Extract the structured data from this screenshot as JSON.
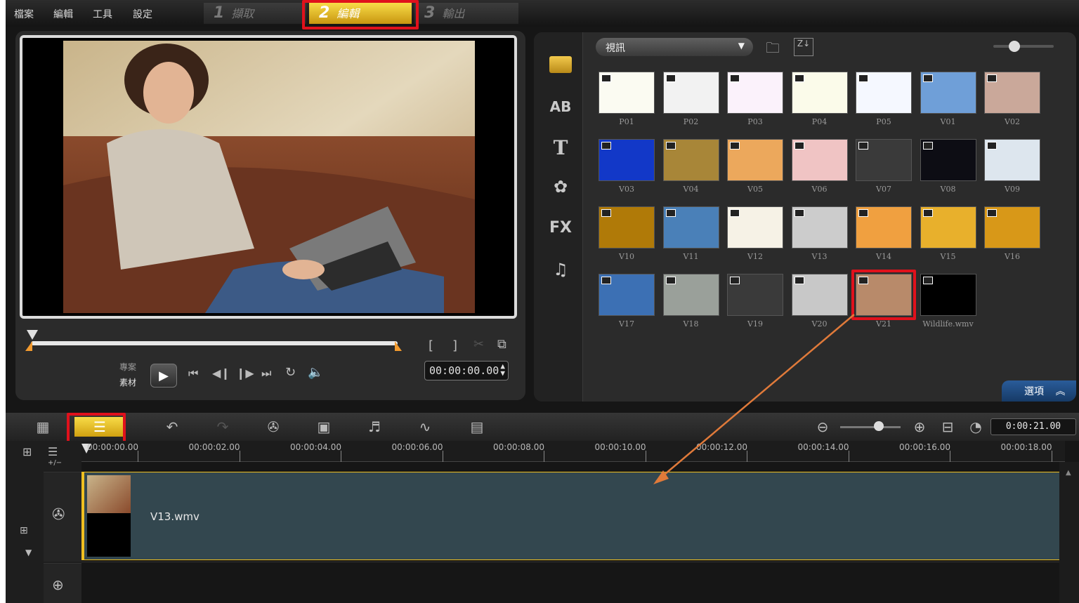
{
  "menu": {
    "file": "檔案",
    "edit": "編輯",
    "tools": "工具",
    "settings": "設定"
  },
  "steps": [
    {
      "num": "1",
      "label": "擷取"
    },
    {
      "num": "2",
      "label": "編輯"
    },
    {
      "num": "3",
      "label": "輸出"
    }
  ],
  "preview": {
    "mark_in": "[",
    "mark_out": "]",
    "mode_project": "專案",
    "mode_clip": "素材",
    "timecode": "00:00:00.00"
  },
  "library": {
    "category": "視訊",
    "options_label": "選項",
    "tab_icons": [
      "media-icon",
      "transition-icon",
      "title-icon",
      "graphic-icon",
      "filter-icon",
      "audio-icon"
    ],
    "tab_texts": [
      "",
      "AB",
      "T",
      "✿",
      "FX",
      "♫"
    ],
    "items": [
      {
        "label": "P01",
        "color": "#fbfbf2"
      },
      {
        "label": "P02",
        "color": "#f2f2f2"
      },
      {
        "label": "P03",
        "color": "#fbf2fb"
      },
      {
        "label": "P04",
        "color": "#fbfbea"
      },
      {
        "label": "P05",
        "color": "#f5f8ff"
      },
      {
        "label": "V01",
        "color": "#6f9fd8"
      },
      {
        "label": "V02",
        "color": "#caa89a"
      },
      {
        "label": "V03",
        "color": "#1238c8"
      },
      {
        "label": "V04",
        "color": "#a88638"
      },
      {
        "label": "V05",
        "color": "#eca85c"
      },
      {
        "label": "V06",
        "color": "#f0c4c4"
      },
      {
        "label": "V07",
        "color": "#3a3a3a"
      },
      {
        "label": "V08",
        "color": "#0d0d14"
      },
      {
        "label": "V09",
        "color": "#dde6ee"
      },
      {
        "label": "V10",
        "color": "#b07a08"
      },
      {
        "label": "V11",
        "color": "#4a80b8"
      },
      {
        "label": "V12",
        "color": "#f6f2e6"
      },
      {
        "label": "V13",
        "color": "#cccccc"
      },
      {
        "label": "V14",
        "color": "#f0a040"
      },
      {
        "label": "V15",
        "color": "#e8b02c"
      },
      {
        "label": "V16",
        "color": "#d89818"
      },
      {
        "label": "V17",
        "color": "#3c70b4"
      },
      {
        "label": "V18",
        "color": "#9aa09a"
      },
      {
        "label": "V19",
        "color": "#3a3a3a"
      },
      {
        "label": "V20",
        "color": "#c8c8c8"
      },
      {
        "label": "V21",
        "color": "#b88a6a"
      },
      {
        "label": "Wildlife.wmv",
        "color": "#000000"
      }
    ]
  },
  "timeline": {
    "duration": "0:00:21.00",
    "add_remove": "+/−",
    "ticks": [
      "00:00:00.00",
      "00:00:02.00",
      "00:00:04.00",
      "00:00:06.00",
      "00:00:08.00",
      "00:00:10.00",
      "00:00:12.00",
      "00:00:14.00",
      "00:00:16.00",
      "00:00:18.00"
    ],
    "clip_name": "V13.wmv"
  },
  "colors": {
    "highlight": "#e0111c",
    "accent": "#f0c020",
    "arrow": "#e07a3a",
    "clip_bg": "#33474f"
  }
}
